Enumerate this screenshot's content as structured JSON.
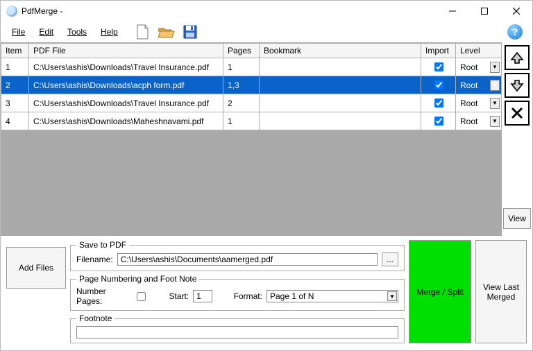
{
  "title": "PdfMerge -",
  "menu": {
    "file": "File",
    "edit": "Edit",
    "tools": "Tools",
    "help": "Help"
  },
  "help_glyph": "?",
  "columns": {
    "item": "Item",
    "file": "PDF File",
    "pages": "Pages",
    "bookmark": "Bookmark",
    "import": "Import",
    "level": "Level"
  },
  "rows": [
    {
      "item": "1",
      "file": "C:\\Users\\ashis\\Downloads\\Travel Insurance.pdf",
      "pages": "1",
      "bookmark": "",
      "import": true,
      "level": "Root",
      "selected": false
    },
    {
      "item": "2",
      "file": "C:\\Users\\ashis\\Downloads\\acph form.pdf",
      "pages": "1,3",
      "bookmark": "",
      "import": true,
      "level": "Root",
      "selected": true
    },
    {
      "item": "3",
      "file": "C:\\Users\\ashis\\Downloads\\Travel Insurance.pdf",
      "pages": "2",
      "bookmark": "",
      "import": true,
      "level": "Root",
      "selected": false
    },
    {
      "item": "4",
      "file": "C:\\Users\\ashis\\Downloads\\Maheshnavami.pdf",
      "pages": "1",
      "bookmark": "",
      "import": true,
      "level": "Root",
      "selected": false
    }
  ],
  "side": {
    "view": "View"
  },
  "bottom": {
    "add_files": "Add Files",
    "save_legend": "Save to PDF",
    "filename_label": "Filename:",
    "filename_value": "C:\\Users\\ashis\\Documents\\aamerged.pdf",
    "browse": "...",
    "numbering_legend": "Page Numbering and Foot Note",
    "number_pages_label": "Number Pages:",
    "start_label": "Start:",
    "start_value": "1",
    "format_label": "Format:",
    "format_value": "Page 1 of N",
    "footnote_legend": "Footnote",
    "footnote_value": "",
    "merge": "Merge / Split",
    "view_last": "View Last Merged"
  }
}
